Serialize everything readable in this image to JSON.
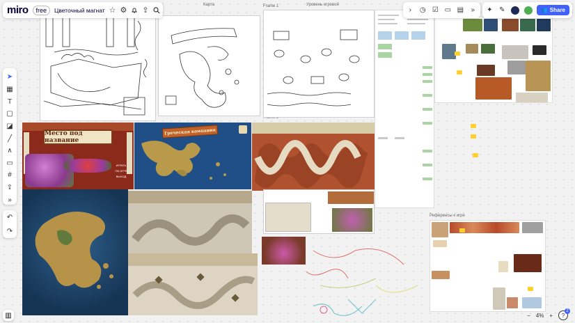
{
  "app": {
    "logo": "miro",
    "plan_badge": "free",
    "board_title": "Цветочный магнат"
  },
  "frames": {
    "karta": "Карта",
    "frame1": "Frame 1",
    "levels": "Уровень игровой",
    "frame2": "Frame 2",
    "refs": "Референсы к игре"
  },
  "art": {
    "title_panel": "Место под название",
    "map_banner": "Греческая компания",
    "btn_play": "ИГРАТЬ",
    "btn_settings": "ОБ ИГРЕ",
    "btn_exit": "ВЫХОД"
  },
  "zoom": {
    "level": "4%"
  },
  "share": {
    "label": "Share"
  },
  "notifications": {
    "count": "2"
  },
  "icons": {
    "toolbar": [
      "star-icon",
      "settings-icon",
      "bell-icon",
      "upload-icon",
      "search-icon"
    ],
    "left": [
      "cursor-icon",
      "frame-template-icon",
      "text-icon",
      "sticky-note-icon",
      "shapes-icon",
      "pen-icon",
      "line-icon",
      "comment-icon",
      "frame-icon",
      "upload-icon",
      "more-icon"
    ],
    "right": [
      "collapse-icon",
      "timer-icon",
      "vote-icon",
      "present-icon",
      "notes-icon",
      "more-icon"
    ]
  },
  "colors": {
    "accent": "#4262ff",
    "sticky": "#ffd02f",
    "sea": "#1f4f86",
    "terracotta": "#8b2a1a"
  }
}
